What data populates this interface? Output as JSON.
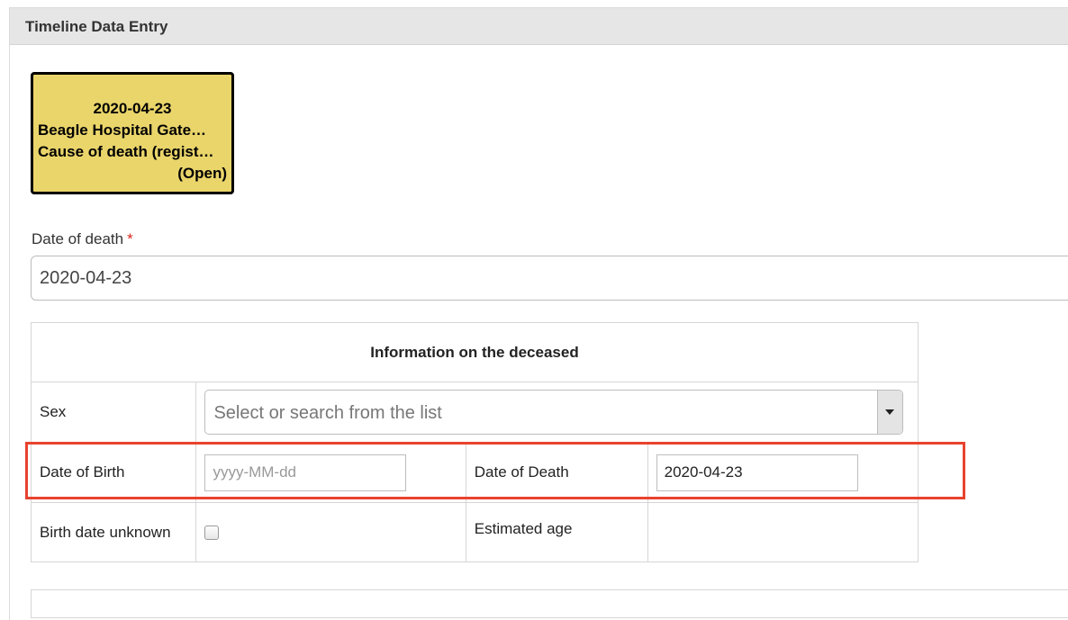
{
  "panel": {
    "title": "Timeline Data Entry"
  },
  "event_card": {
    "date": "2020-04-23",
    "location": "Beagle Hospital Gate…",
    "type": "Cause of death (regist…",
    "status": "(Open)",
    "background_color": "#ead56b"
  },
  "date_of_death_field": {
    "label": "Date of death",
    "required_marker": "*",
    "value": "2020-04-23"
  },
  "deceased_table": {
    "heading": "Information on the deceased",
    "sex": {
      "label": "Sex",
      "placeholder": "Select or search from the list",
      "icon": "chevron-down-icon"
    },
    "date_of_birth": {
      "label": "Date of Birth",
      "placeholder": "yyyy-MM-dd",
      "value": ""
    },
    "date_of_death": {
      "label": "Date of Death",
      "value": "2020-04-23"
    },
    "birth_date_unknown": {
      "label": "Birth date unknown",
      "checked": false
    },
    "estimated_age": {
      "label": "Estimated age",
      "value": ""
    }
  },
  "highlight": {
    "color": "#e8432e"
  }
}
